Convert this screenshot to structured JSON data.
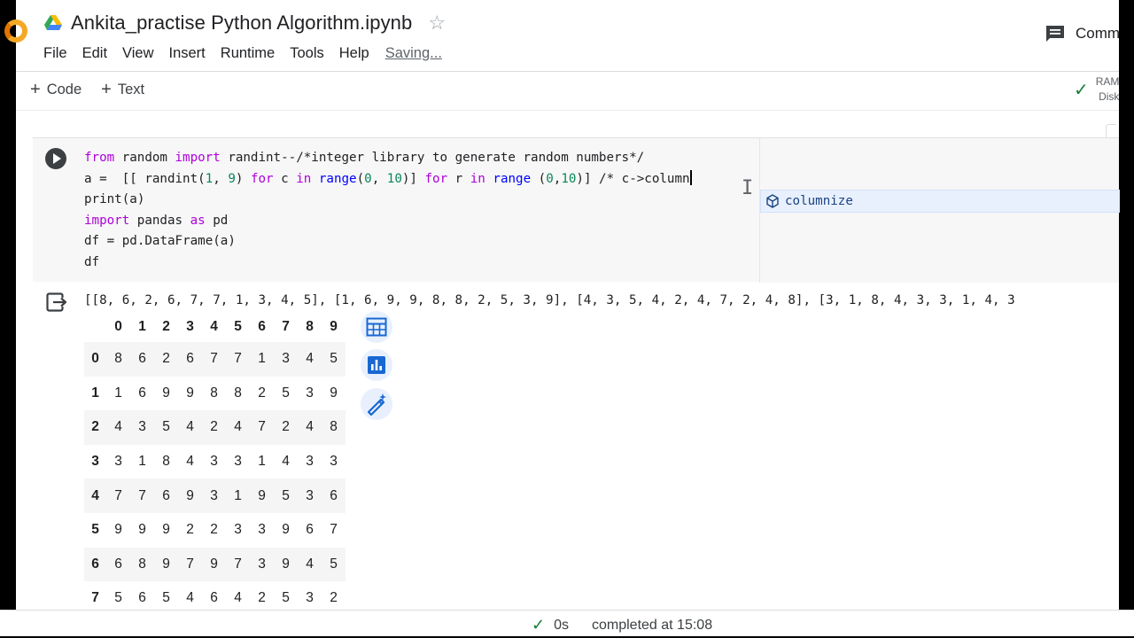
{
  "notebook": {
    "title": "Ankita_practise Python Algorithm.ipynb",
    "saving": "Saving..."
  },
  "menu": [
    "File",
    "Edit",
    "View",
    "Insert",
    "Runtime",
    "Tools",
    "Help"
  ],
  "header": {
    "comment_label": "Comm"
  },
  "toolbar": {
    "code_label": "Code",
    "text_label": "Text"
  },
  "resources": {
    "line1": "RAM",
    "line2": "Disk",
    "status": "connected"
  },
  "cell": {
    "lines": [
      "from random import randint--/*integer library to generate random numbers*/",
      "a =  [[ randint(1, 9) for c in range(0, 10)] for r in range (0,10)] /* c->column",
      "print(a)",
      "import pandas as pd",
      "df = pd.DataFrame(a)",
      "df"
    ],
    "autocomplete": "columnize"
  },
  "output": {
    "printed": "[[8, 6, 2, 6, 7, 7, 1, 3, 4, 5], [1, 6, 9, 9, 8, 8, 2, 5, 3, 9], [4, 3, 5, 4, 2, 4, 7, 2, 4, 8], [3, 1, 8, 4, 3, 3, 1, 4, 3",
    "columns": [
      "0",
      "1",
      "2",
      "3",
      "4",
      "5",
      "6",
      "7",
      "8",
      "9"
    ],
    "rows": [
      {
        "index": "0",
        "values": [
          "8",
          "6",
          "2",
          "6",
          "7",
          "7",
          "1",
          "3",
          "4",
          "5"
        ]
      },
      {
        "index": "1",
        "values": [
          "1",
          "6",
          "9",
          "9",
          "8",
          "8",
          "2",
          "5",
          "3",
          "9"
        ]
      },
      {
        "index": "2",
        "values": [
          "4",
          "3",
          "5",
          "4",
          "2",
          "4",
          "7",
          "2",
          "4",
          "8"
        ]
      },
      {
        "index": "3",
        "values": [
          "3",
          "1",
          "8",
          "4",
          "3",
          "3",
          "1",
          "4",
          "3",
          "3"
        ]
      },
      {
        "index": "4",
        "values": [
          "7",
          "7",
          "6",
          "9",
          "3",
          "1",
          "9",
          "5",
          "3",
          "6"
        ]
      },
      {
        "index": "5",
        "values": [
          "9",
          "9",
          "9",
          "2",
          "2",
          "3",
          "3",
          "9",
          "6",
          "7"
        ]
      },
      {
        "index": "6",
        "values": [
          "6",
          "8",
          "9",
          "7",
          "9",
          "7",
          "3",
          "9",
          "4",
          "5"
        ]
      },
      {
        "index": "7",
        "values": [
          "5",
          "6",
          "5",
          "4",
          "6",
          "4",
          "2",
          "5",
          "3",
          "2"
        ]
      }
    ]
  },
  "status": {
    "duration": "0s",
    "completed": "completed at 15:08"
  },
  "colors": {
    "accent_blue": "#1a73e8",
    "success_green": "#188038",
    "keyword_purple": "#af00db",
    "number_green": "#098658"
  }
}
